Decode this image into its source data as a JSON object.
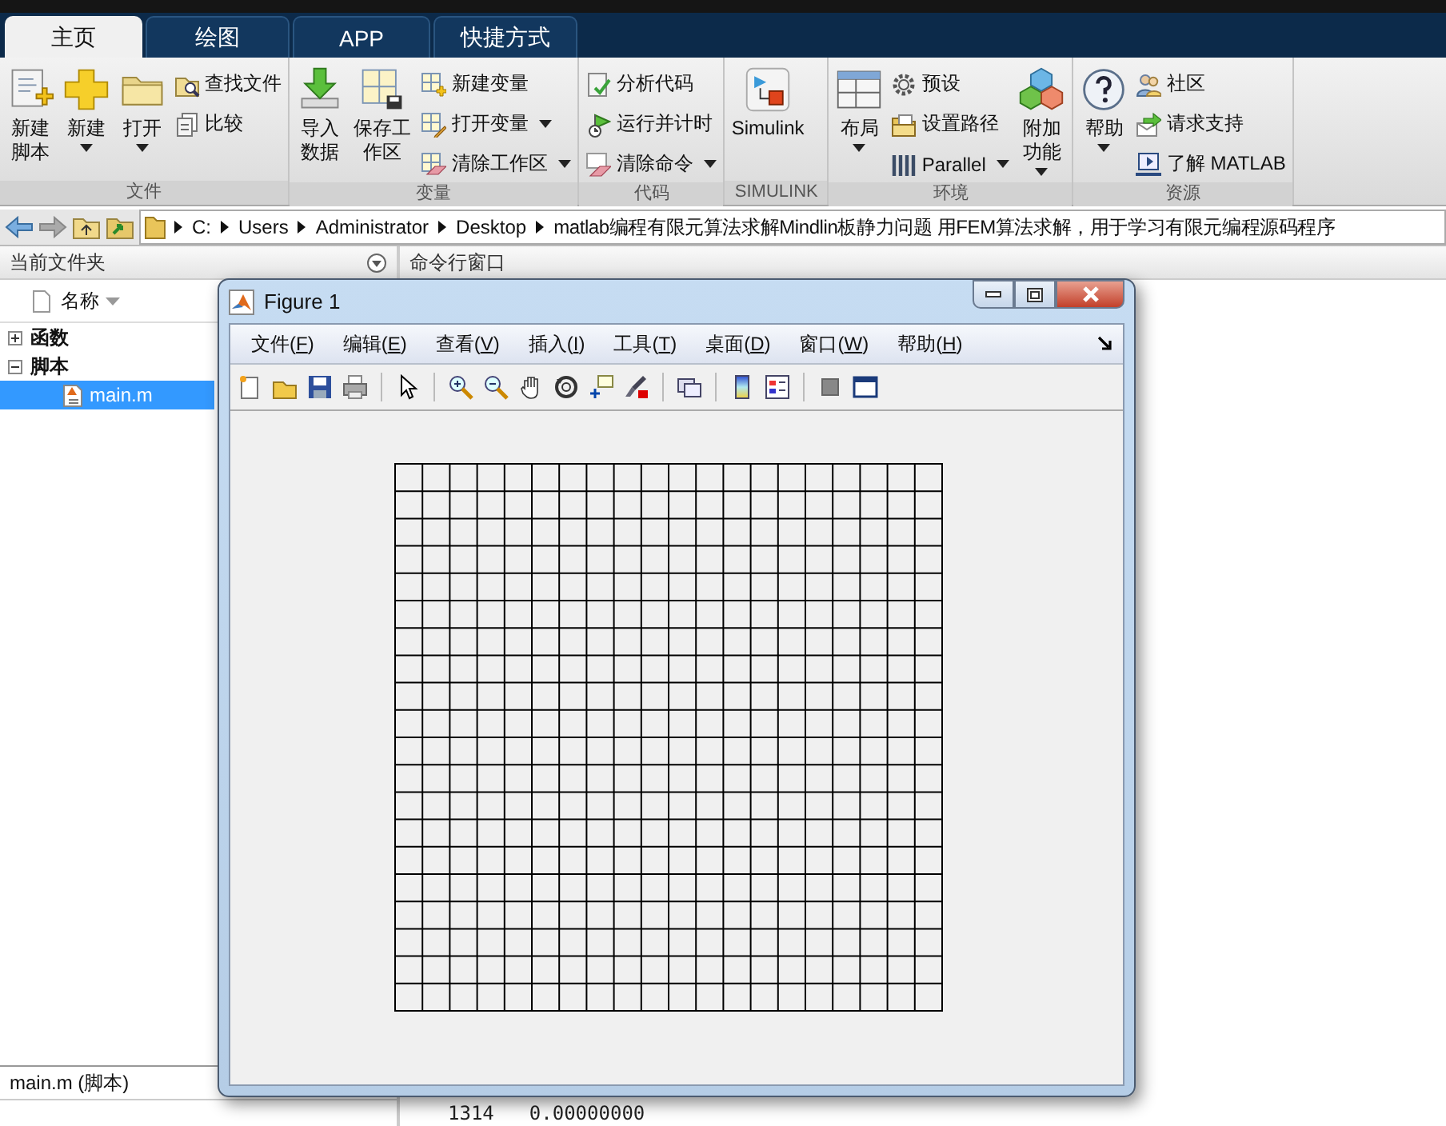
{
  "tabs": [
    {
      "label": "主页",
      "selected": true
    },
    {
      "label": "绘图",
      "selected": false
    },
    {
      "label": "APP",
      "selected": false
    },
    {
      "label": "快捷方式",
      "selected": false
    }
  ],
  "ribbon": {
    "groups": [
      {
        "label": "文件",
        "items": [
          {
            "kind": "large",
            "label": "新建脚本",
            "dropdown": false
          },
          {
            "kind": "large",
            "label": "新建",
            "dropdown": true
          },
          {
            "kind": "large",
            "label": "打开",
            "dropdown": true
          },
          {
            "kind": "column",
            "items": [
              {
                "label": "查找文件",
                "dropdown": false
              },
              {
                "label": "比较",
                "dropdown": false
              }
            ]
          }
        ]
      },
      {
        "label": "变量",
        "items": [
          {
            "kind": "large",
            "label": "导入数据",
            "dropdown": false
          },
          {
            "kind": "large",
            "label": "保存工作区",
            "dropdown": false
          },
          {
            "kind": "column",
            "items": [
              {
                "label": "新建变量",
                "dropdown": false
              },
              {
                "label": "打开变量",
                "dropdown": true
              },
              {
                "label": "清除工作区",
                "dropdown": true
              }
            ]
          }
        ]
      },
      {
        "label": "代码",
        "items": [
          {
            "kind": "column",
            "items": [
              {
                "label": "分析代码",
                "dropdown": false
              },
              {
                "label": "运行并计时",
                "dropdown": false
              },
              {
                "label": "清除命令",
                "dropdown": true
              }
            ]
          }
        ]
      },
      {
        "label": "SIMULINK",
        "items": [
          {
            "kind": "large",
            "label": "Simulink",
            "dropdown": false
          }
        ]
      },
      {
        "label": "环境",
        "items": [
          {
            "kind": "large",
            "label": "布局",
            "dropdown": true
          },
          {
            "kind": "column",
            "items": [
              {
                "label": "预设",
                "dropdown": false
              },
              {
                "label": "设置路径",
                "dropdown": false
              },
              {
                "label": "Parallel",
                "dropdown": true
              }
            ]
          },
          {
            "kind": "large",
            "label": "附加功能",
            "dropdown": true
          }
        ]
      },
      {
        "label": "资源",
        "items": [
          {
            "kind": "large",
            "label": "帮助",
            "dropdown": true
          },
          {
            "kind": "column",
            "items": [
              {
                "label": "社区",
                "dropdown": false
              },
              {
                "label": "请求支持",
                "dropdown": false
              },
              {
                "label": "了解 MATLAB",
                "dropdown": false
              }
            ]
          }
        ]
      }
    ]
  },
  "address_bar": {
    "path": [
      "C:",
      "Users",
      "Administrator",
      "Desktop",
      "matlab编程有限元算法求解Mindlin板静力问题 用FEM算法求解，用于学习有限元编程源码程序"
    ]
  },
  "current_folder": {
    "title": "当前文件夹",
    "column": "名称",
    "tree": [
      {
        "label": "函数",
        "expanded": false,
        "selected": false
      },
      {
        "label": "脚本",
        "expanded": true,
        "selected": false,
        "children": [
          {
            "label": "main.m",
            "selected": true
          }
        ]
      }
    ],
    "details": "main.m  (脚本)"
  },
  "command_window": {
    "title": "命令行窗口",
    "lines": [
      {
        "index": "1314",
        "value": "0.00000000"
      }
    ]
  },
  "figure": {
    "title": "Figure 1",
    "menu": [
      "文件(F)",
      "编辑(E)",
      "查看(V)",
      "插入(I)",
      "工具(T)",
      "桌面(D)",
      "窗口(W)",
      "帮助(H)"
    ]
  }
}
